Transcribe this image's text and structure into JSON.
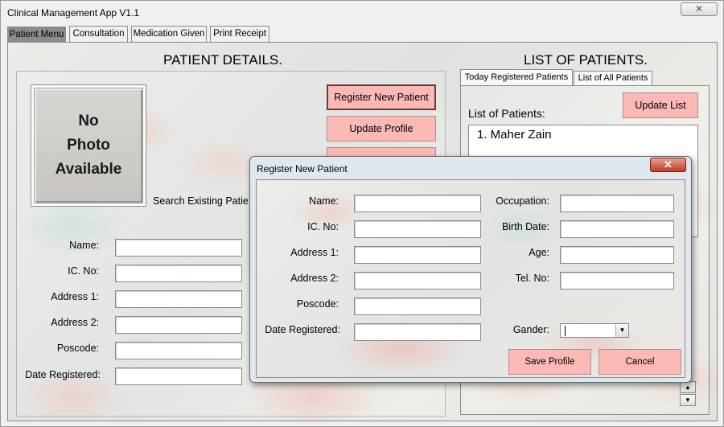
{
  "window": {
    "title": "Clinical Management App V1.1",
    "close_glyph": "✕"
  },
  "main_tabs": [
    {
      "label": "Patient Menu"
    },
    {
      "label": "Consultation"
    },
    {
      "label": "Medication Given"
    },
    {
      "label": "Print Receipt"
    }
  ],
  "patient_details": {
    "title": "PATIENT DETAILS.",
    "photo_text": "No\nPhoto\nAvailable",
    "search_label": "Search Existing Patie",
    "buttons": {
      "register": "Register New Patient",
      "update_profile": "Update Profile"
    },
    "fields": [
      {
        "label": "Name:",
        "value": ""
      },
      {
        "label": "IC. No:",
        "value": ""
      },
      {
        "label": "Address 1:",
        "value": ""
      },
      {
        "label": "Address 2:",
        "value": ""
      },
      {
        "label": "Poscode:",
        "value": ""
      },
      {
        "label": "Date Registered:",
        "value": ""
      }
    ]
  },
  "patient_list": {
    "title": "LIST OF PATIENTS.",
    "tabs": [
      {
        "label": "Today Registered Patients"
      },
      {
        "label": "List of All Patients"
      }
    ],
    "list_label": "List of Patients:",
    "update_button": "Update List",
    "items": [
      "1. Maher Zain"
    ]
  },
  "dialog": {
    "title": "Register New Patient",
    "close_glyph": "✕",
    "left_fields": [
      {
        "label": "Name:",
        "value": ""
      },
      {
        "label": "IC. No:",
        "value": ""
      },
      {
        "label": "Address 1:",
        "value": ""
      },
      {
        "label": "Address 2:",
        "value": ""
      },
      {
        "label": "Poscode:",
        "value": ""
      },
      {
        "label": "Date Registered:",
        "value": ""
      }
    ],
    "right_fields": [
      {
        "label": "Occupation:",
        "value": ""
      },
      {
        "label": "Birth Date:",
        "value": ""
      },
      {
        "label": "Age:",
        "value": ""
      },
      {
        "label": "Tel. No:",
        "value": ""
      }
    ],
    "gender_label": "Gander:",
    "gender_value": "",
    "save_button": "Save Profile",
    "cancel_button": "Cancel"
  },
  "icons": {
    "dropdown": "▼",
    "scroll_up": "▲",
    "scroll_down": "▼"
  },
  "colors": {
    "button_pink": "#fbb9b6",
    "dialog_close_red": "#c43b28",
    "active_tab": "#8c8c8c"
  }
}
